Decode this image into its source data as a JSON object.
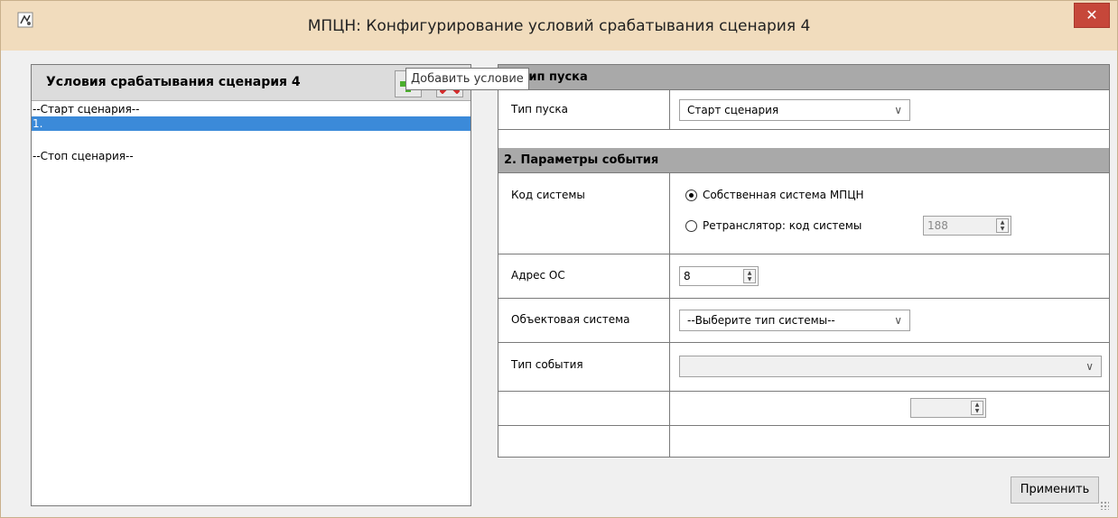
{
  "window": {
    "title": "МПЦН: Конфигурирование условий срабатывания сценария 4",
    "close_label": "✕"
  },
  "left": {
    "title": "Условия срабатывания сценария 4",
    "items": [
      "--Старт сценария--",
      "1.",
      "--Стоп сценария--"
    ],
    "tooltip": "Добавить условие"
  },
  "section1": {
    "header": "1. Тип пуска",
    "launch_type_label": "Тип пуска",
    "launch_type_value": "Старт сценария"
  },
  "section2": {
    "header": "2. Параметры события",
    "system_code_label": "Код системы",
    "own_system_label": "Собственная система МПЦН",
    "relay_label": "Ретранслятор: код системы",
    "relay_code_value": "188",
    "os_address_label": "Адрес ОС",
    "os_address_value": "8",
    "object_system_label": "Объектовая система",
    "object_system_value": "--Выберите тип системы--",
    "event_type_label": "Тип события",
    "event_type_value": ""
  },
  "buttons": {
    "apply": "Применить"
  },
  "colors": {
    "titlebar": "#f1dcbd",
    "close": "#c6473a",
    "selection": "#3b8ad9",
    "section_header": "#a9a9a9"
  },
  "icons": {
    "app": "app-icon",
    "add": "plus-icon",
    "delete": "x-icon",
    "close": "close-icon"
  }
}
